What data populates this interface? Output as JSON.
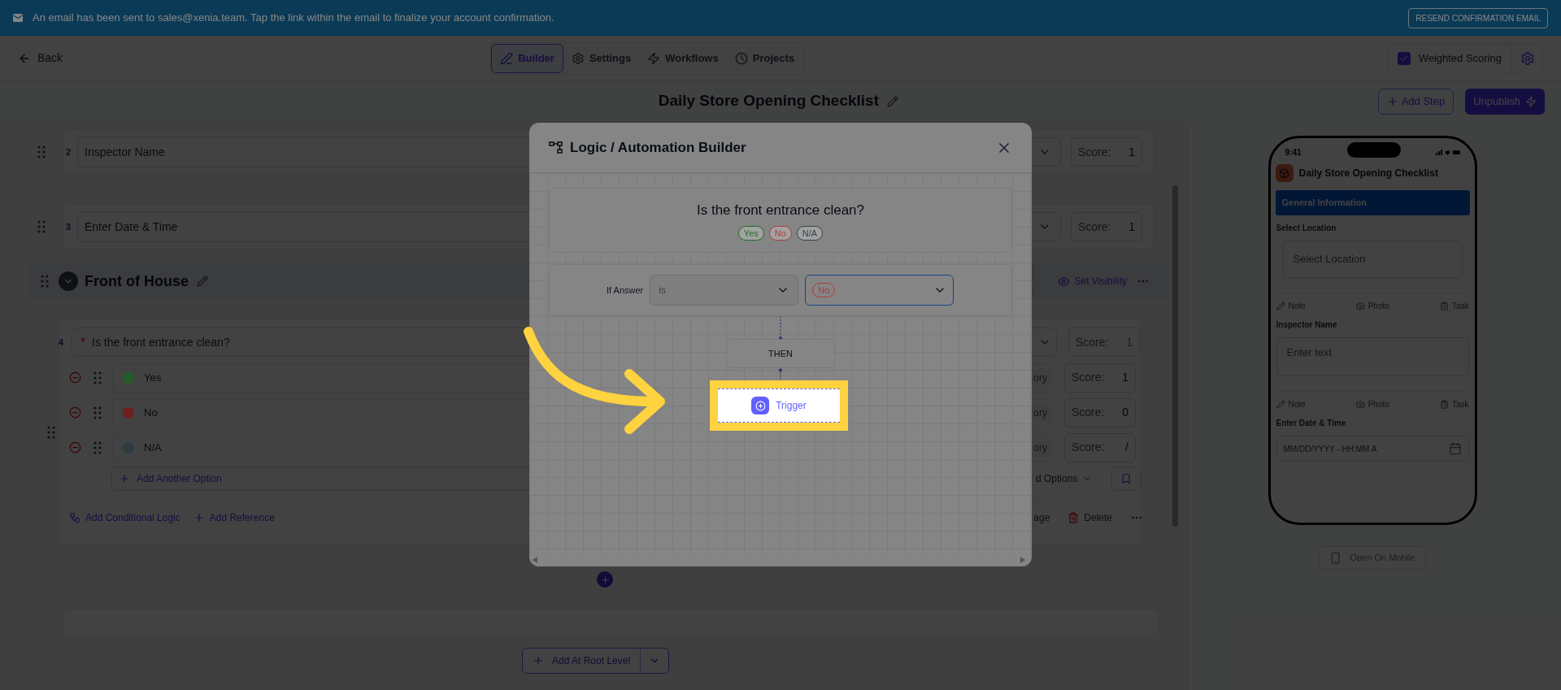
{
  "banner": {
    "message": "An email has been sent to sales@xenia.team. Tap the link within the email to finalize your account confirmation.",
    "button": "RESEND CONFIRMATION EMAIL"
  },
  "header": {
    "back": "Back",
    "tabs": [
      {
        "label": "Builder",
        "selected": true
      },
      {
        "label": "Settings",
        "selected": false
      },
      {
        "label": "Workflows",
        "selected": false
      },
      {
        "label": "Projects",
        "selected": false
      }
    ],
    "weighted_scoring": {
      "label": "Weighted Scoring",
      "checked": true
    }
  },
  "title_bar": {
    "title": "Daily Store Opening Checklist",
    "add_step": "Add Step",
    "unpublish": "Unpublish"
  },
  "editor": {
    "questions": [
      {
        "number": "2",
        "title": "Inspector Name",
        "score_label": "Score:",
        "score": "1"
      },
      {
        "number": "3",
        "title": "Enter Date & Time",
        "score_label": "Score:",
        "score": "1"
      }
    ],
    "section": {
      "title": "Front of House",
      "set_visibility": "Set Visibility"
    },
    "question": {
      "number": "4",
      "required": true,
      "title": "Is the front entrance clean?",
      "score_label": "Score:",
      "score": "1",
      "options": [
        {
          "label": "Yes",
          "color": "#245c2a",
          "category": "ory",
          "score_label": "Score:",
          "score": "1"
        },
        {
          "label": "No",
          "color": "#6e1f1f",
          "category": "ory",
          "score_label": "Score:",
          "score": "0"
        },
        {
          "label": "N/A",
          "color": "#2f3b42",
          "category": "ory",
          "score_label": "Score:",
          "score": "/"
        }
      ],
      "add_option": "Add Another Option",
      "advanced_options": "d Options",
      "conditional_logic": "Add Conditional Logic",
      "reference": "Add Reference",
      "image": "age",
      "delete": "Delete"
    },
    "add_root": "Add At Root Level"
  },
  "modal": {
    "title": "Logic / Automation Builder",
    "question": "Is the front entrance clean?",
    "answers": [
      {
        "label": "Yes",
        "color": "#1e6b22"
      },
      {
        "label": "No",
        "color": "#b03a3a"
      },
      {
        "label": "N/A",
        "color": "#36434a"
      }
    ],
    "condition_label": "If Answer",
    "operator": "is",
    "value": {
      "label": "No",
      "color": "#b03a3a"
    },
    "then": "THEN",
    "trigger": "Trigger"
  },
  "preview": {
    "time": "9:41",
    "title": "Daily Store Opening Checklist",
    "section": "General Information",
    "fields": [
      {
        "kind": "select",
        "label": "Select Location",
        "placeholder": "Select Location",
        "actions": [
          "Note",
          "Photo",
          "Task"
        ]
      },
      {
        "kind": "text",
        "label": "Inspector Name",
        "placeholder": "Enter text",
        "actions": [
          "Note",
          "Photo",
          "Task"
        ]
      },
      {
        "kind": "datetime",
        "label": "Enter Date & Time",
        "placeholder": "MM/DD/YYYY - HH:MM A"
      }
    ],
    "open_mobile": "Open On Mobile"
  }
}
